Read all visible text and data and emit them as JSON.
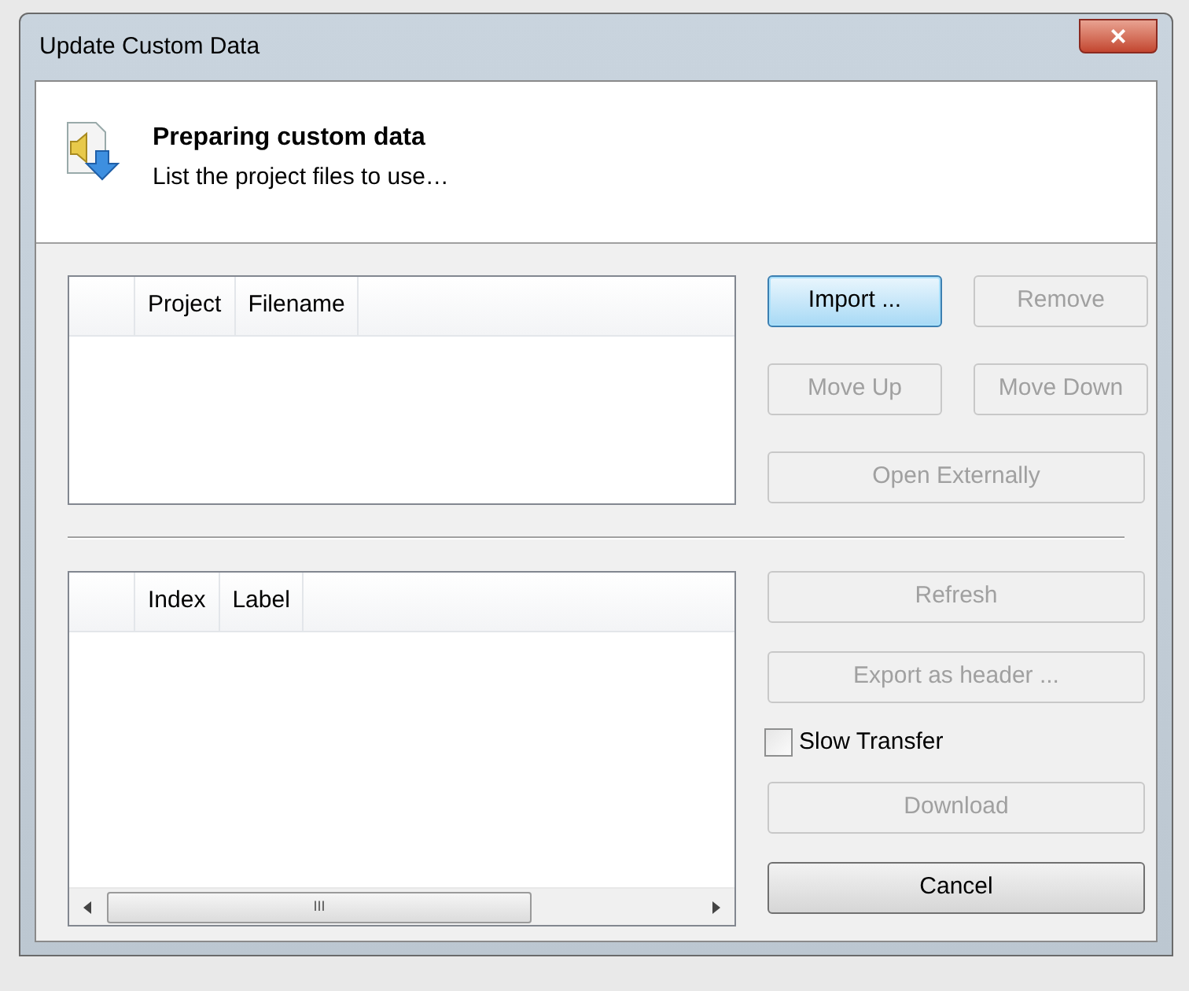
{
  "window": {
    "title": "Update Custom Data",
    "close": "×"
  },
  "header": {
    "title": "Preparing custom data",
    "subtitle": "List the project files to use…"
  },
  "project_table": {
    "columns": [
      "Project",
      "Filename"
    ]
  },
  "index_table": {
    "columns": [
      "Index",
      "Label"
    ],
    "scrollbar_grip": "III"
  },
  "top_buttons": [
    {
      "label": "Import ...",
      "disabled": false,
      "focused": true
    },
    {
      "label": "Remove",
      "disabled": true,
      "focused": false
    },
    {
      "label": "Move Up",
      "disabled": true,
      "focused": false
    },
    {
      "label": "Move Down",
      "disabled": true,
      "focused": false
    },
    {
      "label": "Open Externally",
      "disabled": true,
      "focused": false
    }
  ],
  "bottom_controls": [
    {
      "kind": "button",
      "label": "Refresh",
      "disabled": true
    },
    {
      "kind": "button",
      "label": "Export as header ...",
      "disabled": true
    },
    {
      "kind": "checkbox",
      "label": "Slow Transfer",
      "checked": false
    },
    {
      "kind": "button",
      "label": "Download",
      "disabled": true
    },
    {
      "kind": "button",
      "label": "Cancel",
      "disabled": false
    }
  ]
}
